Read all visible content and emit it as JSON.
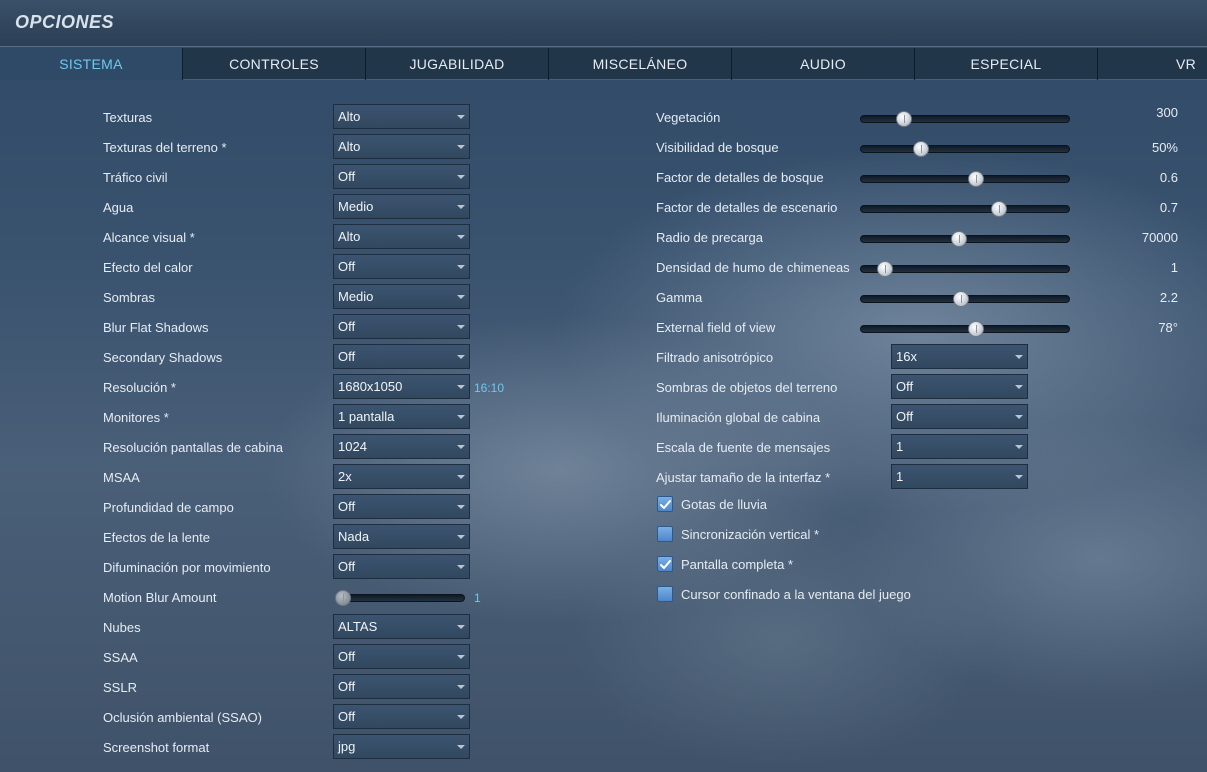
{
  "app": {
    "title": "OPCIONES"
  },
  "tabs": [
    "SISTEMA",
    "CONTROLES",
    "JUGABILIDAD",
    "MISCELÁNEO",
    "AUDIO",
    "ESPECIAL",
    "VR"
  ],
  "left": {
    "rows": [
      {
        "label": "Texturas",
        "value": "Alto"
      },
      {
        "label": "Texturas del terreno *",
        "value": "Alto"
      },
      {
        "label": "Tráfico civil",
        "value": "Off"
      },
      {
        "label": "Agua",
        "value": "Medio"
      },
      {
        "label": "Alcance visual *",
        "value": "Alto"
      },
      {
        "label": "Efecto del calor",
        "value": "Off"
      },
      {
        "label": "Sombras",
        "value": "Medio"
      },
      {
        "label": "Blur Flat Shadows",
        "value": "Off"
      },
      {
        "label": "Secondary Shadows",
        "value": "Off"
      },
      {
        "label": "Resolución *",
        "value": "1680x1050"
      },
      {
        "label": "Monitores *",
        "value": "1 pantalla"
      },
      {
        "label": "Resolución pantallas de cabina",
        "value": "1024"
      },
      {
        "label": "MSAA",
        "value": "2x"
      },
      {
        "label": "Profundidad de campo",
        "value": "Off"
      },
      {
        "label": "Efectos de la lente",
        "value": "Nada"
      },
      {
        "label": "Difuminación por movimiento",
        "value": "Off"
      },
      {
        "label": "Motion Blur Amount",
        "value": "1"
      },
      {
        "label": "Nubes",
        "value": "ALTAS"
      },
      {
        "label": "SSAA",
        "value": "Off"
      },
      {
        "label": "SSLR",
        "value": "Off"
      },
      {
        "label": "Oclusión ambiental (SSAO)",
        "value": "Off"
      },
      {
        "label": "Screenshot format",
        "value": "jpg"
      }
    ],
    "aspect_ratio": "16:10",
    "motion_blur_level": 0.0
  },
  "right": {
    "sliders": [
      {
        "label": "Vegetación",
        "value": "300",
        "level": 0.21
      },
      {
        "label": "Visibilidad de bosque",
        "value": "50%",
        "level": 0.29
      },
      {
        "label": "Factor de detalles de bosque",
        "value": "0.6",
        "level": 0.55
      },
      {
        "label": "Factor de detalles de escenario",
        "value": "0.7",
        "level": 0.66
      },
      {
        "label": "Radio de precarga",
        "value": "70000",
        "level": 0.47
      },
      {
        "label": "Densidad de humo de chimeneas",
        "value": "1",
        "level": 0.12
      },
      {
        "label": "Gamma",
        "value": "2.2",
        "level": 0.48
      },
      {
        "label": "External field of view",
        "value": "78°",
        "level": 0.55
      }
    ],
    "selects": [
      {
        "label": "Filtrado anisotrópico",
        "value": "16x"
      },
      {
        "label": "Sombras de objetos del terreno",
        "value": "Off"
      },
      {
        "label": "Iluminación global de cabina",
        "value": "Off"
      },
      {
        "label": "Escala de fuente de mensajes",
        "value": "1"
      },
      {
        "label": "Ajustar tamaño de la interfaz *",
        "value": "1"
      }
    ],
    "checks": [
      {
        "label": "Gotas de lluvia",
        "checked": true
      },
      {
        "label": "Sincronización vertical *",
        "checked": false
      },
      {
        "label": "Pantalla completa *",
        "checked": true
      },
      {
        "label": "Cursor confinado a la ventana del juego",
        "checked": false
      }
    ]
  },
  "colors": {
    "accent": "#6ec8ef",
    "tabbar": "#22364a",
    "checkbox": "#5b93d4"
  },
  "icons": {
    "checkmark": "check-icon",
    "dropdown": "chevron-down-icon"
  }
}
